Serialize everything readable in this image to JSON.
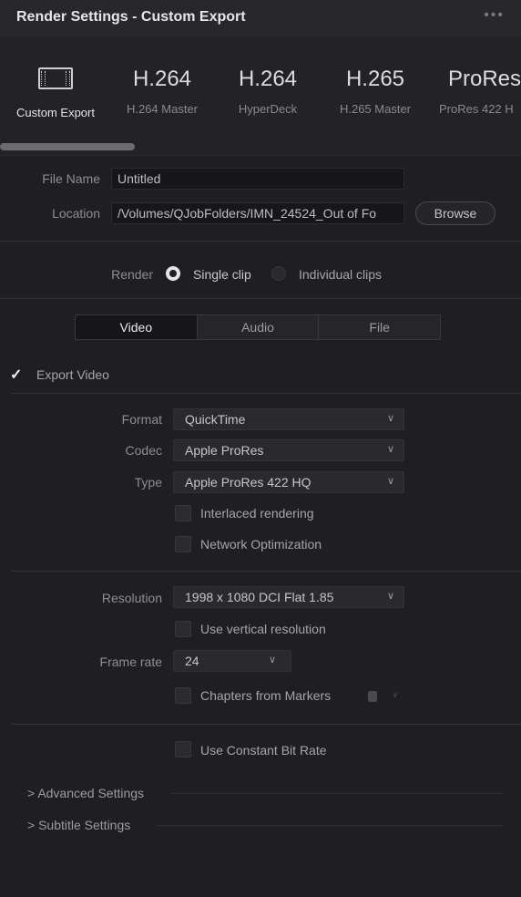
{
  "window": {
    "title": "Render Settings - Custom Export",
    "more": "•••"
  },
  "presets": [
    {
      "big": "",
      "icon": "film-icon",
      "label": "Custom Export",
      "selected": true
    },
    {
      "big": "H.264",
      "label": "H.264 Master"
    },
    {
      "big": "H.264",
      "label": "HyperDeck"
    },
    {
      "big": "H.265",
      "label": "H.265 Master"
    },
    {
      "big": "ProRes",
      "label": "ProRes 422 H"
    }
  ],
  "file": {
    "name_label": "File Name",
    "name_value": "Untitled",
    "location_label": "Location",
    "location_value": "/Volumes/QJobFolders/IMN_24524_Out of Fo",
    "browse_label": "Browse"
  },
  "render": {
    "label": "Render",
    "option1": "Single clip",
    "option2": "Individual clips",
    "selected": "Single clip"
  },
  "tabs": {
    "video": "Video",
    "audio": "Audio",
    "file": "File",
    "active": "Video"
  },
  "video": {
    "export_label": "Export Video",
    "export_checked": true,
    "format_label": "Format",
    "format_value": "QuickTime",
    "codec_label": "Codec",
    "codec_value": "Apple ProRes",
    "type_label": "Type",
    "type_value": "Apple ProRes 422 HQ",
    "interlaced_label": "Interlaced rendering",
    "network_label": "Network Optimization",
    "resolution_label": "Resolution",
    "resolution_value": "1998 x 1080 DCI Flat 1.85",
    "vertical_label": "Use vertical resolution",
    "framerate_label": "Frame rate",
    "framerate_value": "24",
    "chapters_label": "Chapters from Markers",
    "cbr_label": "Use Constant Bit Rate"
  },
  "sections": {
    "advanced": "Advanced Settings",
    "subtitle": "Subtitle Settings"
  },
  "glyphs": {
    "chevron": "∨",
    "arrow": ">",
    "check": "✓"
  }
}
